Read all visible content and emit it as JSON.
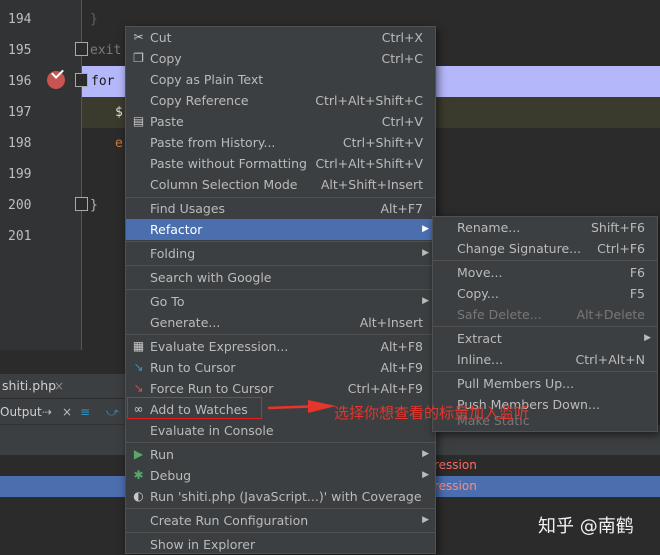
{
  "editor": {
    "line_numbers": [
      "194",
      "195",
      "196",
      "197",
      "198",
      "199",
      "200",
      "201"
    ],
    "code": {
      "l194": "}",
      "l195": "exit",
      "l196": "for",
      "l197": "$",
      "l198": "e",
      "l200": "}"
    }
  },
  "tab": {
    "file_name": "shiti.php",
    "close": "×"
  },
  "debug_toolbar": {
    "label": "Output"
  },
  "panel": {
    "row1_text": "ression",
    "row2_text": "ression"
  },
  "context_menu": {
    "items": [
      {
        "label": "Cut",
        "shortcut": "Ctrl+X",
        "icon": "scissors-icon"
      },
      {
        "label": "Copy",
        "shortcut": "Ctrl+C",
        "icon": "copy-icon"
      },
      {
        "label": "Copy as Plain Text",
        "shortcut": ""
      },
      {
        "label": "Copy Reference",
        "shortcut": "Ctrl+Alt+Shift+C"
      },
      {
        "label": "Paste",
        "shortcut": "Ctrl+V",
        "icon": "clipboard-icon"
      },
      {
        "label": "Paste from History...",
        "shortcut": "Ctrl+Shift+V"
      },
      {
        "label": "Paste without Formatting",
        "shortcut": "Ctrl+Alt+Shift+V"
      },
      {
        "label": "Column Selection Mode",
        "shortcut": "Alt+Shift+Insert"
      },
      {
        "label": "Find Usages",
        "shortcut": "Alt+F7"
      },
      {
        "label": "Refactor",
        "shortcut": "",
        "submenu": true,
        "selected": true
      },
      {
        "label": "Folding",
        "shortcut": "",
        "submenu": true
      },
      {
        "label": "Search with Google",
        "shortcut": ""
      },
      {
        "label": "Go To",
        "shortcut": "",
        "submenu": true
      },
      {
        "label": "Generate...",
        "shortcut": "Alt+Insert"
      },
      {
        "label": "Evaluate Expression...",
        "shortcut": "Alt+F8",
        "icon": "calculator-icon"
      },
      {
        "label": "Run to Cursor",
        "shortcut": "Alt+F9",
        "icon": "run-to-cursor-icon"
      },
      {
        "label": "Force Run to Cursor",
        "shortcut": "Ctrl+Alt+F9",
        "icon": "force-run-to-cursor-icon"
      },
      {
        "label": "Add to Watches",
        "shortcut": "",
        "icon": "watch-glasses-icon"
      },
      {
        "label": "Evaluate in Console",
        "shortcut": ""
      },
      {
        "label": "Run",
        "shortcut": "",
        "submenu": true,
        "icon": "run-icon"
      },
      {
        "label": "Debug",
        "shortcut": "",
        "submenu": true,
        "icon": "debug-bug-icon"
      },
      {
        "label": "Run 'shiti.php (JavaScript...)' with Coverage",
        "shortcut": "",
        "icon": "coverage-shield-icon"
      },
      {
        "label": "Create Run Configuration",
        "shortcut": "",
        "submenu": true
      },
      {
        "label": "Show in Explorer",
        "shortcut": ""
      }
    ]
  },
  "refactor_submenu": {
    "items": [
      {
        "label": "Rename...",
        "shortcut": "Shift+F6"
      },
      {
        "label": "Change Signature...",
        "shortcut": "Ctrl+F6"
      },
      {
        "label": "Move...",
        "shortcut": "F6"
      },
      {
        "label": "Copy...",
        "shortcut": "F5"
      },
      {
        "label": "Safe Delete...",
        "shortcut": "Alt+Delete",
        "disabled": true
      },
      {
        "label": "Extract",
        "shortcut": "",
        "submenu": true
      },
      {
        "label": "Inline...",
        "shortcut": "Ctrl+Alt+N"
      },
      {
        "label": "Pull Members Up...",
        "shortcut": ""
      },
      {
        "label": "Push Members Down...",
        "shortcut": ""
      },
      {
        "label": "Make Static",
        "shortcut": "",
        "disabled": true
      }
    ]
  },
  "annotation": {
    "text": "选择你想查看的标量加入监听"
  },
  "watermark": "知乎 @南鹤",
  "colors": {
    "accent": "#4b6eaf",
    "annotation": "#e6352b",
    "breakpoint": "#c75450"
  }
}
